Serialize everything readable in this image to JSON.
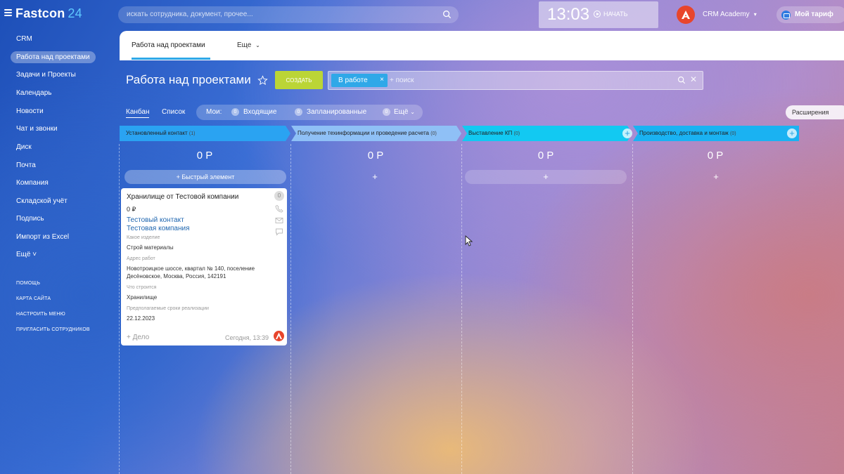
{
  "app": {
    "logo_name": "Fastcon",
    "logo_number": "24",
    "search_placeholder": "искать сотрудника, документ, прочее...",
    "clock": "13:03",
    "start_label": "НАЧАТЬ",
    "user_name": "CRM Academy",
    "tariff_label": "Мой тариф"
  },
  "sidebar": {
    "items": [
      {
        "label": "CRM"
      },
      {
        "label": "Работа над проектами"
      },
      {
        "label": "Задачи и Проекты"
      },
      {
        "label": "Календарь"
      },
      {
        "label": "Новости"
      },
      {
        "label": "Чат и звонки"
      },
      {
        "label": "Диск"
      },
      {
        "label": "Почта"
      },
      {
        "label": "Компания"
      },
      {
        "label": "Складской учёт"
      },
      {
        "label": "Подпись"
      },
      {
        "label": "Импорт из Excel"
      },
      {
        "label": "Ещё"
      }
    ],
    "more_chevron": "˅",
    "footer_links": [
      {
        "label": "ПОМОЩЬ"
      },
      {
        "label": "КАРТА САЙТА"
      },
      {
        "label": "НАСТРОИТЬ МЕНЮ"
      },
      {
        "label": "ПРИГЛАСИТЬ СОТРУДНИКОВ"
      }
    ]
  },
  "tabs": {
    "active": "Работа над проектами",
    "more": "Еще"
  },
  "header": {
    "title": "Работа над проектами",
    "create_label": "СОЗДАТЬ",
    "filter_chip": "В работе",
    "filter_placeholder": "+ поиск"
  },
  "views": {
    "kanban": "Канбан",
    "list": "Список",
    "mine_label": "Мои:",
    "counters": [
      {
        "count": "0",
        "label": "Входящие"
      },
      {
        "count": "0",
        "label": "Запланированные"
      },
      {
        "count": "0",
        "label": "Ещё"
      }
    ],
    "extensions_label": "Расширения"
  },
  "stages": [
    {
      "name": "Установленный контакт",
      "count": "(1)",
      "sum": "0 Р",
      "color": "#2aa3f2"
    },
    {
      "name": "Получение техинформации и проведение расчета",
      "count": "(0)",
      "sum": "0 Р",
      "color": "#7fb8f5"
    },
    {
      "name": "Выставление КП",
      "count": "(0)",
      "sum": "0 Р",
      "color": "#12c9f2"
    },
    {
      "name": "Производство, доставка и монтаж",
      "count": "(0)",
      "sum": "0 Р",
      "color": "#1ab2f2"
    }
  ],
  "quick_add_label": "+ Быстрый элемент",
  "add_symbol": "+",
  "deal_card": {
    "title": "Хранилище от Тестовой компании",
    "badge": "0",
    "sum": "0 ₽",
    "contact": "Тестовый контакт",
    "company": "Тестовая компания",
    "fields": [
      {
        "label": "Какое изделие",
        "value": "Строй материалы"
      },
      {
        "label": "Адрес работ",
        "value": "Новотроицкое шоссе, квартал № 140, поселение Десёновское, Москва, Россия, 142191"
      },
      {
        "label": "Что строится",
        "value": "Хранилище"
      },
      {
        "label": "Предполагаемые сроки реализации",
        "value": "22.12.2023"
      }
    ],
    "add_activity": "+ Дело",
    "date": "Сегодня, 13:39"
  },
  "colors": {
    "accent": "#2fa8e8",
    "create_button": "#bbd536",
    "brand_logo": "#e8452c"
  }
}
